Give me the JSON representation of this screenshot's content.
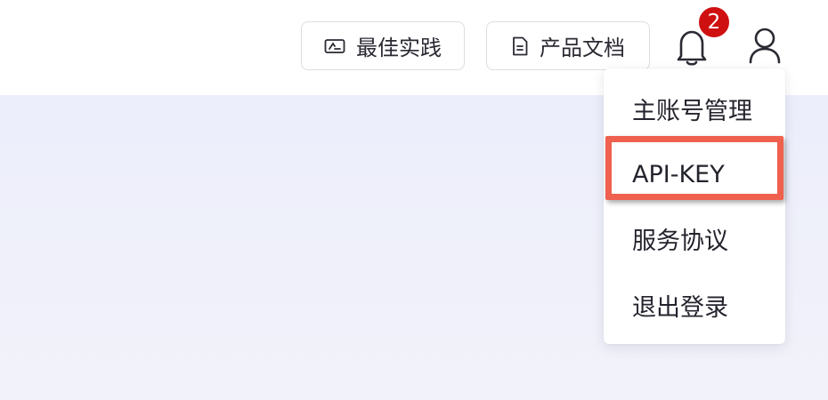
{
  "header": {
    "best_practice_label": "最佳实践",
    "product_docs_label": "产品文档",
    "notification_count": "2"
  },
  "account_menu": {
    "items": [
      {
        "label": "主账号管理"
      },
      {
        "label": "API-KEY",
        "highlighted": true
      },
      {
        "label": "服务协议"
      },
      {
        "label": "退出登录"
      }
    ]
  },
  "colors": {
    "badge": "#cf1010",
    "highlight_border": "#f0604f",
    "content_background": "#eceefb"
  }
}
